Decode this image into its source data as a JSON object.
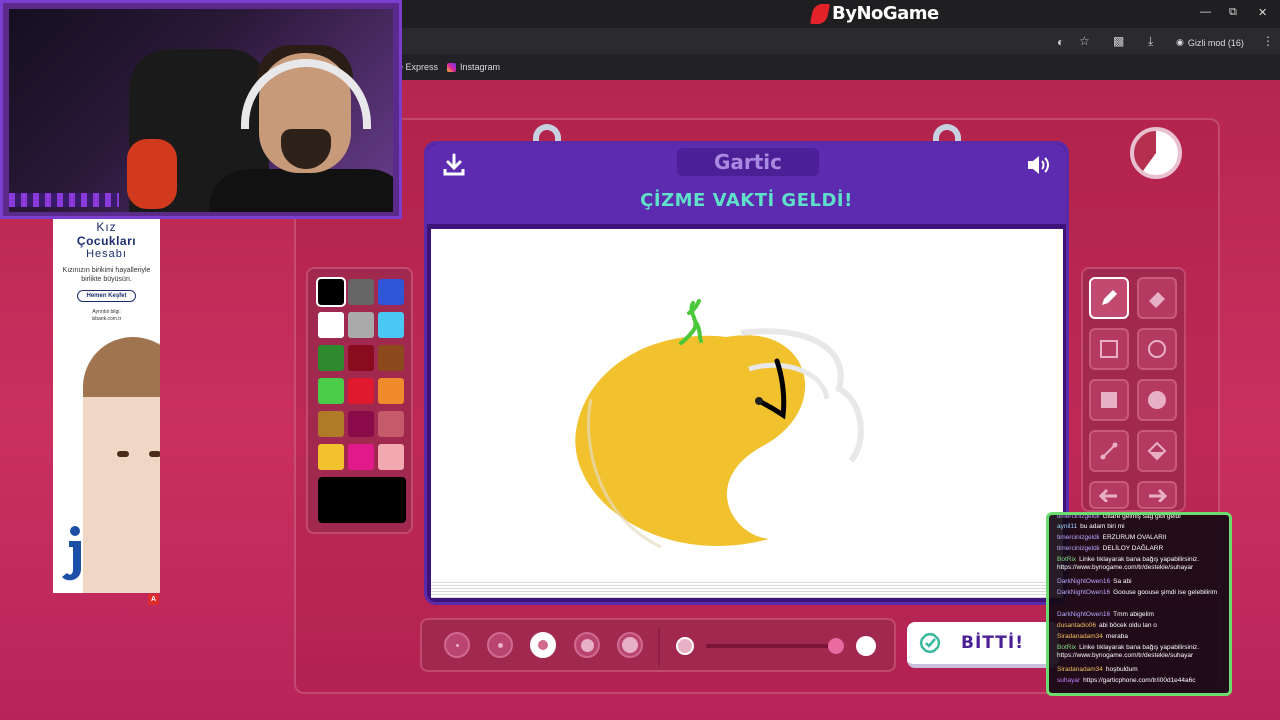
{
  "browser": {
    "brand": "ByNoGame",
    "bookmarks": [
      "e Express",
      "Instagram"
    ],
    "incognito_label": "Gizli mod (16)",
    "controls": [
      "minimize-icon",
      "restore-icon",
      "close-icon"
    ]
  },
  "ad": {
    "title_line1": "Kız",
    "title_line2": "Çocukları",
    "title_line3": "Hesabı",
    "description": "Kızınızın birikimi hayalleriyle birlikte büyüsün.",
    "button": "Hemen Keşfet",
    "info_line1": "Ayrıntılı bilgi:",
    "info_line2": "isbank.com.tr",
    "badge": "A"
  },
  "game": {
    "logo": "Gartic",
    "headline": "ÇİZME VAKTİ GELDİ!",
    "done_label": "BİTTİ!",
    "timer_remaining_fraction": 0.6,
    "selected_color": "#000000",
    "palette": [
      "#000000",
      "#666666",
      "#2f56d6",
      "#ffffff",
      "#aaaaaa",
      "#4ac8f4",
      "#2e8a2e",
      "#8a0a1e",
      "#8c4a1c",
      "#4acc4a",
      "#e01a2e",
      "#f08a2a",
      "#b07a28",
      "#8a0a4a",
      "#c45a6a",
      "#f2c12e",
      "#e01a8a",
      "#f2aab0"
    ],
    "tools": [
      "pencil-icon",
      "eraser-icon",
      "square-outline-icon",
      "circle-outline-icon",
      "square-filled-icon",
      "circle-filled-icon",
      "line-icon",
      "fill-bucket-icon",
      "undo-icon",
      "redo-icon"
    ],
    "brush_sizes": 5,
    "selected_brush_size": 3
  },
  "chat": [
    {
      "user": "timercinizgeldii",
      "text": "Gitare gelmiş sağ gibi geldi",
      "color": "#b9a7ff"
    },
    {
      "user": "aynil11",
      "text": "bu adam biri mi",
      "color": "#9ad0ff"
    },
    {
      "user": "timercinizgeldii",
      "text": "ERZURUM OVALARII",
      "color": "#b9a7ff"
    },
    {
      "user": "timercinizgeldii",
      "text": "DELİLOY DAĞLARR",
      "color": "#b9a7ff"
    },
    {
      "user": "BotRix",
      "text": "Linke tıklayarak bana bağış yapabilirsiniz. https://www.bynogame.com/tr/destekle/suhayar",
      "color": "#7ee07e"
    },
    {
      "user": "DarkNightOwen16",
      "text": "Sa abi",
      "color": "#b9a7ff"
    },
    {
      "user": "DarkNightOwen16",
      "text": "Goouse goouse şimdi ise gelebilirim",
      "color": "#b9a7ff"
    },
    {
      "user": "DarkNightOwen16",
      "text": "Tmm abigelim",
      "color": "#b9a7ff"
    },
    {
      "user": "dusantadio06",
      "text": "abi böcek oldu lan o",
      "color": "#f0c060"
    },
    {
      "user": "Siradanadam34",
      "text": "meraba",
      "color": "#f0c060"
    },
    {
      "user": "BotRix",
      "text": "Linke tıklayarak bana bağış yapabilirsiniz. https://www.bynogame.com/tr/destekle/suhayar",
      "color": "#7ee07e"
    },
    {
      "user": "Siradanadam34",
      "text": "hoşbuldum",
      "color": "#f0c060"
    },
    {
      "user": "suhayar",
      "text": "https://garticphone.com/tr/i00d1e44a6c",
      "color": "#c080ff"
    }
  ]
}
